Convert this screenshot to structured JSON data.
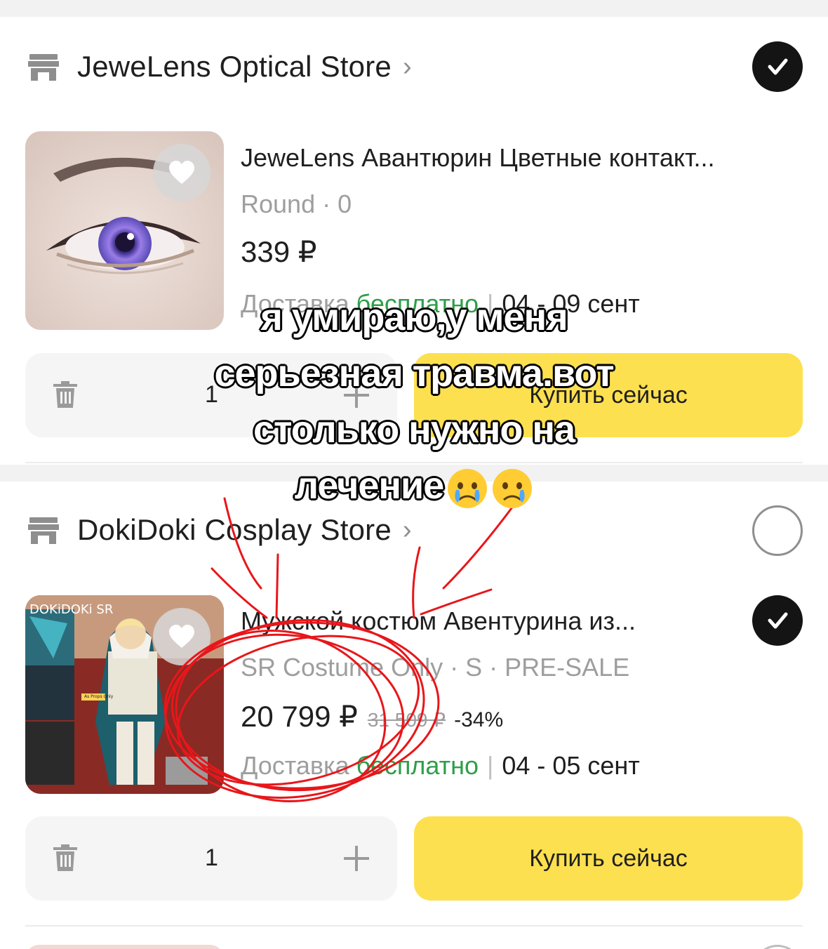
{
  "stores": [
    {
      "name": "JeweLens Optical Store",
      "chevron": "›",
      "selected": true,
      "item": {
        "title": "JeweLens Авантюрин Цветные контакт...",
        "variant": "Round · 0",
        "price": "339 ₽",
        "delivery_label": "Доставка",
        "delivery_free": "бесплатно",
        "delivery_dates": "04 - 09 сент",
        "quantity": "1",
        "buy_label": "Купить сейчас",
        "selected": true
      }
    },
    {
      "name": "DokiDoki Cosplay Store",
      "chevron": "›",
      "selected": false,
      "item": {
        "title": "Мужской костюм Авентурина из...",
        "variant": "SR Costume Only · S · PRE-SALE",
        "price": "20 799 ₽",
        "old_price": "31 509 ₽",
        "discount": "-34%",
        "delivery_label": "Доставка",
        "delivery_free": "бесплатно",
        "delivery_dates": "04 - 05 сент",
        "quantity": "1",
        "buy_label": "Купить сейчас",
        "selected": true,
        "image_brand_text": "DOKiDOKi SR",
        "image_caption": "As Props Only"
      }
    }
  ],
  "overlay": {
    "lines": [
      "я умираю,у меня",
      "серьезная травма.вот",
      "столько нужно на",
      "лечение"
    ],
    "emoji": "crying-face-emoji"
  },
  "icons": {
    "store": "store-icon",
    "check": "checkmark-icon",
    "heart": "heart-icon",
    "trash": "trash-icon",
    "plus": "plus-icon"
  },
  "colors": {
    "buy_button": "#fde050",
    "free_delivery": "#2f9e49",
    "check_selected": "#141414",
    "scribble": "#e8161a"
  }
}
